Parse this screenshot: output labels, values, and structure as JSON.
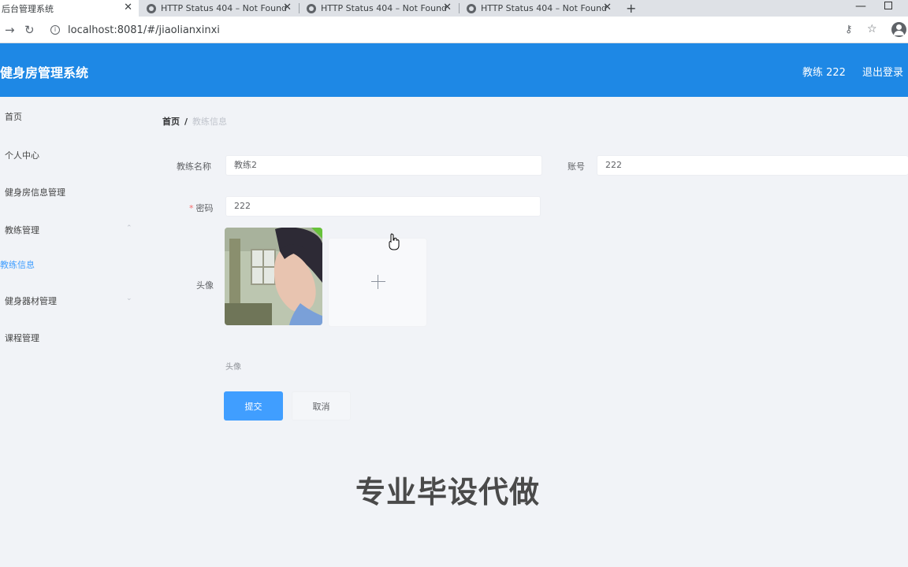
{
  "browser": {
    "tabs": [
      {
        "title": "后台管理系统",
        "active": true
      },
      {
        "title": "HTTP Status 404 – Not Found",
        "active": false
      },
      {
        "title": "HTTP Status 404 – Not Found",
        "active": false
      },
      {
        "title": "HTTP Status 404 – Not Found",
        "active": false
      }
    ],
    "url": "localhost:8081/#/jiaolianxinxi"
  },
  "header": {
    "title": "健身房管理系统",
    "user": "教练 222",
    "logout": "退出登录",
    "color": "#1e88e5"
  },
  "sidebar": {
    "items": [
      {
        "label": "首页"
      },
      {
        "label": "个人中心"
      },
      {
        "label": "健身房信息管理"
      },
      {
        "label": "教练管理"
      },
      {
        "label": "教练信息"
      },
      {
        "label": "健身器材管理"
      },
      {
        "label": "课程管理"
      }
    ],
    "active_color": "#409eff"
  },
  "breadcrumb": {
    "home": "首页",
    "separator": "/",
    "current": "教练信息"
  },
  "form": {
    "name_label": "教练名称",
    "name_value": "教练2",
    "account_label": "账号",
    "account_value": "222",
    "password_label": "密码",
    "password_required": "*",
    "password_value": "222",
    "avatar_label": "头像",
    "avatar_hint": "头像",
    "submit_label": "提交",
    "cancel_label": "取消",
    "primary_color": "#409eff"
  },
  "watermark": "专业毕设代做"
}
